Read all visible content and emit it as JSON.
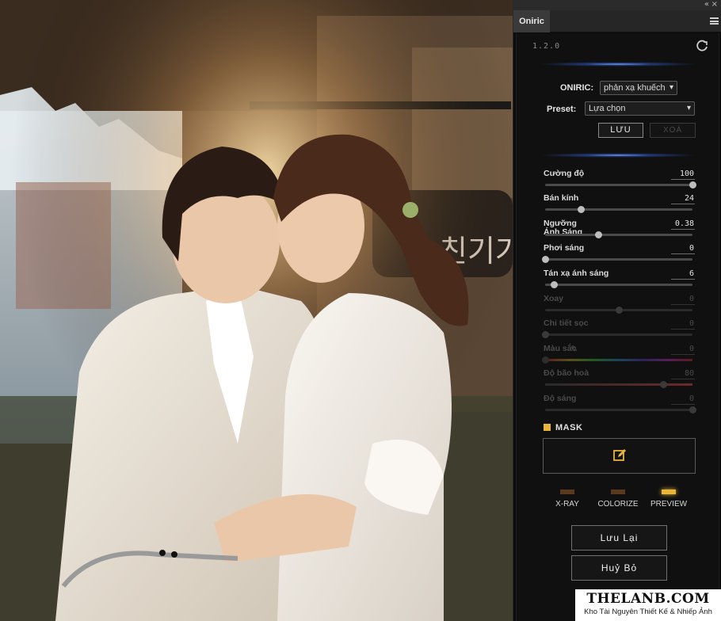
{
  "panel": {
    "tab_label": "Oniric",
    "version": "1.2.0",
    "oniric_label": "ONIRIC:",
    "oniric_value": "phản xạ khuếch",
    "preset_label": "Preset:",
    "preset_value": "Lựa chọn",
    "save_label": "LƯU",
    "delete_label": "XOÁ",
    "sliders": [
      {
        "label": "Cường độ",
        "value": "100",
        "fraction": 1.0,
        "enabled": true
      },
      {
        "label": "Bán kính",
        "value": "24",
        "fraction": 0.24,
        "enabled": true
      },
      {
        "label": "Ngưỡng Ánh Sáng",
        "value": "0.38",
        "fraction": 0.36,
        "enabled": true
      },
      {
        "label": "Phơi sáng",
        "value": "0",
        "fraction": 0.0,
        "enabled": true
      },
      {
        "label": "Tán xạ ánh sáng",
        "value": "6",
        "fraction": 0.06,
        "enabled": true
      },
      {
        "label": "Xoay",
        "value": "0",
        "fraction": 0.5,
        "enabled": false
      },
      {
        "label": "Chi tiết sọc",
        "value": "0",
        "fraction": 0.0,
        "enabled": false
      },
      {
        "label": "Màu sắc",
        "value": "0",
        "fraction": 0.0,
        "enabled": false
      },
      {
        "label": "Độ bão hoà",
        "value": "80",
        "fraction": 0.8,
        "enabled": false
      },
      {
        "label": "Độ sáng",
        "value": "0",
        "fraction": 1.0,
        "enabled": false
      }
    ],
    "mask_label": "MASK",
    "toggles": [
      {
        "label": "X-RAY",
        "active": false
      },
      {
        "label": "COLORIZE",
        "active": false
      },
      {
        "label": "PREVIEW",
        "active": true
      }
    ],
    "apply_label": "Lưu Lại",
    "cancel_label": "Huỷ Bỏ"
  },
  "watermark": {
    "title": "THELANB.COM",
    "subtitle": "Kho Tài Nguyên Thiết Kế & Nhiếp Ảnh"
  },
  "colors": {
    "accent": "#e6b53a",
    "glow": "#6ea0ff",
    "panel_bg": "#101011"
  }
}
